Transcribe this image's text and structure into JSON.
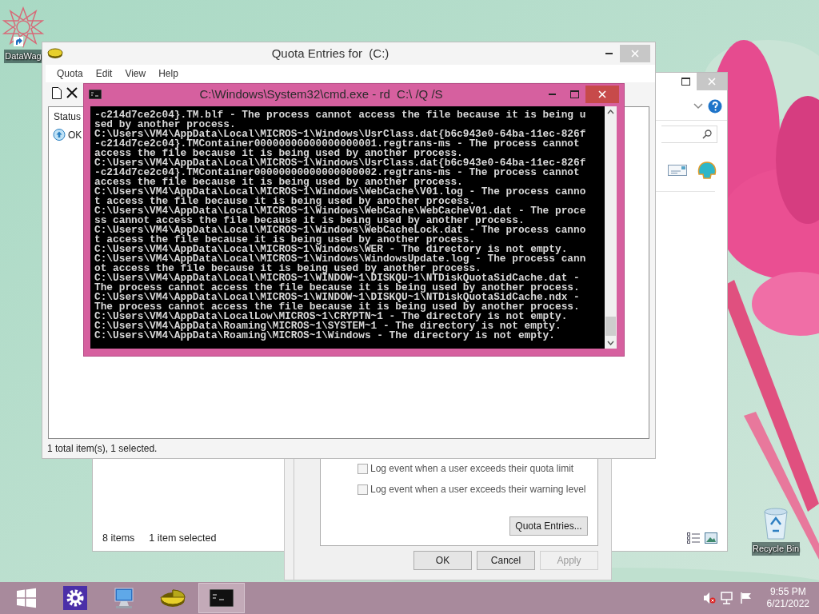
{
  "desktop_icons": [
    {
      "label": "DataWag",
      "kind": "app"
    },
    {
      "label": "Recycle Bin",
      "kind": "bin"
    }
  ],
  "explorer_window": {
    "status_items": "8 items",
    "status_selected": "1 item selected"
  },
  "properties_dialog": {
    "checkboxes": [
      {
        "label": "Log event when a user exceeds their quota limit",
        "checked": false
      },
      {
        "label": "Log event when a user exceeds their warning level",
        "checked": false
      }
    ],
    "quota_entries_button": "Quota Entries...",
    "buttons": [
      {
        "label": "OK",
        "disabled": false
      },
      {
        "label": "Cancel",
        "disabled": false
      },
      {
        "label": "Apply",
        "disabled": true
      }
    ]
  },
  "quota_window": {
    "title": "Quota Entries for  (C:)",
    "menu": [
      "Quota",
      "Edit",
      "View",
      "Help"
    ],
    "columns": [
      "Status"
    ],
    "rows": [
      {
        "status": "OK"
      }
    ],
    "status_bar": "1 total item(s), 1 selected."
  },
  "cmd_window": {
    "title": "C:\\Windows\\System32\\cmd.exe - rd  C:\\ /Q /S",
    "lines": [
      "-c214d7ce2c04}.TM.blf - The process cannot access the file because it is being u",
      "sed by another process.",
      "C:\\Users\\VM4\\AppData\\Local\\MICROS~1\\Windows\\UsrClass.dat{b6c943e0-64ba-11ec-826f",
      "-c214d7ce2c04}.TMContainer00000000000000000001.regtrans-ms - The process cannot",
      "access the file because it is being used by another process.",
      "C:\\Users\\VM4\\AppData\\Local\\MICROS~1\\Windows\\UsrClass.dat{b6c943e0-64ba-11ec-826f",
      "-c214d7ce2c04}.TMContainer00000000000000000002.regtrans-ms - The process cannot",
      "access the file because it is being used by another process.",
      "C:\\Users\\VM4\\AppData\\Local\\MICROS~1\\Windows\\WebCache\\V01.log - The process canno",
      "t access the file because it is being used by another process.",
      "C:\\Users\\VM4\\AppData\\Local\\MICROS~1\\Windows\\WebCache\\WebCacheV01.dat - The proce",
      "ss cannot access the file because it is being used by another process.",
      "C:\\Users\\VM4\\AppData\\Local\\MICROS~1\\Windows\\WebCacheLock.dat - The process canno",
      "t access the file because it is being used by another process.",
      "C:\\Users\\VM4\\AppData\\Local\\MICROS~1\\Windows\\WER - The directory is not empty.",
      "C:\\Users\\VM4\\AppData\\Local\\MICROS~1\\Windows\\WindowsUpdate.log - The process cann",
      "ot access the file because it is being used by another process.",
      "C:\\Users\\VM4\\AppData\\Local\\MICROS~1\\WINDOW~1\\DISKQU~1\\NTDiskQuotaSidCache.dat -",
      "The process cannot access the file because it is being used by another process.",
      "C:\\Users\\VM4\\AppData\\Local\\MICROS~1\\WINDOW~1\\DISKQU~1\\NTDiskQuotaSidCache.ndx -",
      "The process cannot access the file because it is being used by another process.",
      "C:\\Users\\VM4\\AppData\\LocalLow\\MICROS~1\\CRYPTN~1 - The directory is not empty.",
      "C:\\Users\\VM4\\AppData\\Roaming\\MICROS~1\\SYSTEM~1 - The directory is not empty.",
      "C:\\Users\\VM4\\AppData\\Roaming\\MICROS~1\\Windows - The directory is not empty."
    ]
  },
  "taskbar": {
    "apps": [
      {
        "kind": "settings",
        "active": false
      },
      {
        "kind": "computer",
        "active": false
      },
      {
        "kind": "quota",
        "active": false
      },
      {
        "kind": "console",
        "active": true
      }
    ],
    "time": "9:55 PM",
    "date": "6/21/2022"
  }
}
